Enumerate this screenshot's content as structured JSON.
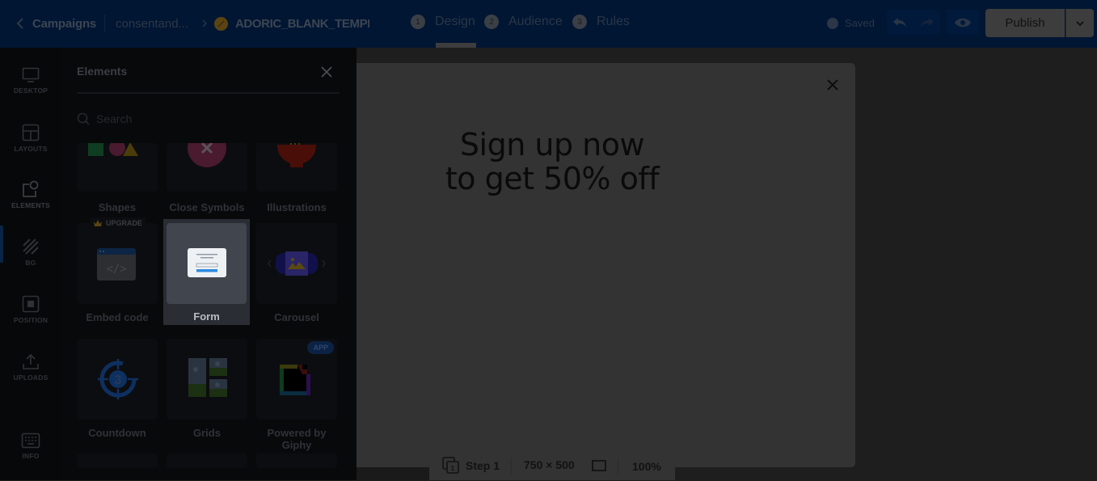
{
  "header": {
    "back_label": "Campaigns",
    "breadcrumb_campaign": "consentand...",
    "template_name": "ADORIC_BLANK_TEMPL",
    "steps": [
      {
        "num": "1",
        "label": "Design"
      },
      {
        "num": "2",
        "label": "Audience"
      },
      {
        "num": "3",
        "label": "Rules"
      }
    ],
    "active_step": "Design",
    "saved_label": "Saved",
    "publish_label": "Publish"
  },
  "rail": {
    "items": [
      {
        "label": "DESKTOP",
        "icon": "monitor-icon"
      },
      {
        "label": "LAYOUTS",
        "icon": "layout-icon"
      },
      {
        "label": "ELEMENTS",
        "icon": "elements-icon"
      },
      {
        "label": "BG",
        "icon": "background-stripes-icon"
      },
      {
        "label": "POSITION",
        "icon": "position-icon"
      },
      {
        "label": "UPLOADS",
        "icon": "upload-icon"
      },
      {
        "label": "INFO",
        "icon": "keyboard-icon"
      }
    ],
    "active": "ELEMENTS"
  },
  "panel": {
    "title": "Elements",
    "search_placeholder": "Search",
    "tiles": [
      {
        "label": "Shapes"
      },
      {
        "label": "Close Symbols"
      },
      {
        "label": "Illustrations"
      },
      {
        "label": "Embed code",
        "badge": "UPGRADE"
      },
      {
        "label": "Form",
        "selected": true
      },
      {
        "label": "Carousel"
      },
      {
        "label": "Countdown",
        "icon_text": "3"
      },
      {
        "label": "Grids"
      },
      {
        "label": "Powered by Giphy",
        "badge": "APP"
      }
    ]
  },
  "canvas": {
    "headline_line1": "Sign up now",
    "headline_line2": "to get 50% off"
  },
  "statusbar": {
    "step_label": "Step 1",
    "step_icon_num": "1",
    "size_label": "750 × 500",
    "zoom_label": "100%"
  },
  "colors": {
    "topbar_bg": "#001633",
    "overlay_panel": "#08090b",
    "popup_bg": "#333333",
    "canvas_bg": "#1e1e1e"
  }
}
